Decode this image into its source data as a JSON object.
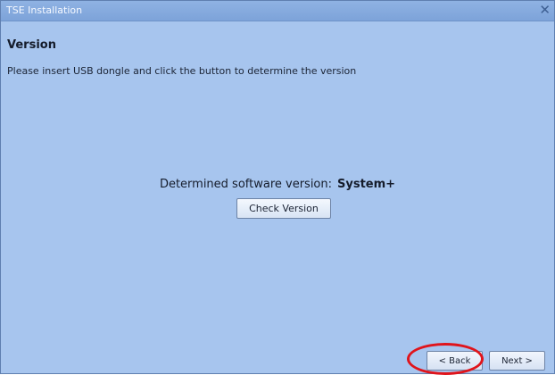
{
  "window": {
    "title": "TSE Installation",
    "close_glyph": "✕"
  },
  "page": {
    "heading": "Version",
    "instruction": "Please insert USB dongle and click the button to determine the version",
    "determined_label": "Determined software version:",
    "determined_value": "System+",
    "check_button_label": "Check Version"
  },
  "nav": {
    "back_label": "< Back",
    "next_label": "Next >"
  },
  "annotation": {
    "highlight_color": "#e0141b",
    "highlight_target": "back-button"
  }
}
